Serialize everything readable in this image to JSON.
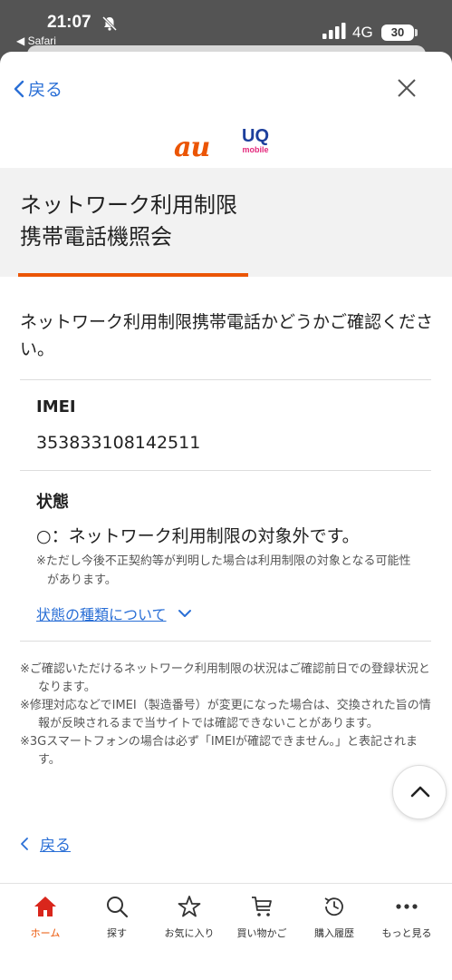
{
  "status_bar": {
    "time": "21:07",
    "back_app": "◀ Safari",
    "network": "4G",
    "battery": "30"
  },
  "nav": {
    "back_label": "戻る"
  },
  "page": {
    "title_line1": "ネットワーク利用制限",
    "title_line2": "携帯電話機照会",
    "intro": "ネットワーク利用制限携帯電話かどうかご確認ください。",
    "imei_label": "IMEI",
    "imei_value": "353833108142511",
    "status_label": "状態",
    "status_value": "○：ネットワーク利用制限の対象外です。",
    "status_note": "※ただし今後不正契約等が判明した場合は利用制限の対象となる可能性があります。",
    "status_types_link": "状態の種類について",
    "notes": [
      "※ご確認いただけるネットワーク利用制限の状況はご確認前日での登録状況となります。",
      "※修理対応などでIMEI（製造番号）が変更になった場合は、交換された旨の情報が反映されるまで当サイトでは確認できないことがあります。",
      "※3Gスマートフォンの場合は必ず「IMEIが確認できません。」と表記されます。"
    ],
    "back_bottom_label": "戻る"
  },
  "tabbar": {
    "items": [
      {
        "label": "ホーム",
        "icon": "home-icon",
        "active": true
      },
      {
        "label": "探す",
        "icon": "search-icon",
        "active": false
      },
      {
        "label": "お気に入り",
        "icon": "star-icon",
        "active": false
      },
      {
        "label": "買い物かご",
        "icon": "cart-icon",
        "active": false
      },
      {
        "label": "購入履歴",
        "icon": "history-icon",
        "active": false
      },
      {
        "label": "もっと見る",
        "icon": "more-icon",
        "active": false
      }
    ]
  },
  "colors": {
    "accent": "#eb5505",
    "link": "#2a6fd6",
    "uq_blue": "#1d3f9c",
    "uq_pink": "#e4287c"
  },
  "brand": {
    "au": "au",
    "uq": "UQ",
    "uq_sub": "mobile"
  }
}
